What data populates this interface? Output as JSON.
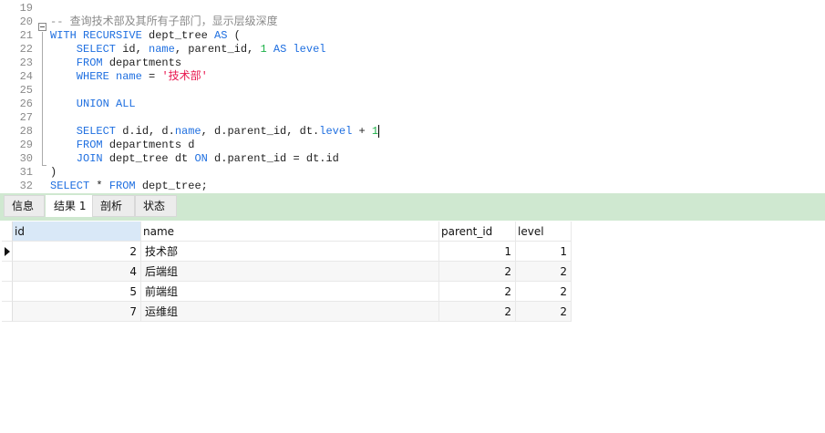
{
  "editor": {
    "lines": [
      {
        "n": "19",
        "tokens": []
      },
      {
        "n": "20",
        "tokens": [
          {
            "t": "-- 查询技术部及其所有子部门，显示层级深度",
            "c": "cm"
          }
        ]
      },
      {
        "n": "21",
        "tokens": [
          {
            "t": "WITH RECURSIVE ",
            "c": "kw"
          },
          {
            "t": "dept_tree ",
            "c": "id"
          },
          {
            "t": "AS",
            "c": "kw"
          },
          {
            "t": " (",
            "c": "id"
          }
        ]
      },
      {
        "n": "22",
        "tokens": [
          {
            "t": "    SELECT ",
            "c": "kw"
          },
          {
            "t": "id, ",
            "c": "id"
          },
          {
            "t": "name",
            "c": "kw"
          },
          {
            "t": ", parent_id, ",
            "c": "id"
          },
          {
            "t": "1 ",
            "c": "num"
          },
          {
            "t": "AS level",
            "c": "kw"
          }
        ]
      },
      {
        "n": "23",
        "tokens": [
          {
            "t": "    FROM ",
            "c": "kw"
          },
          {
            "t": "departments",
            "c": "id"
          }
        ]
      },
      {
        "n": "24",
        "tokens": [
          {
            "t": "    WHERE name ",
            "c": "kw"
          },
          {
            "t": "= ",
            "c": "id"
          },
          {
            "t": "'技术部'",
            "c": "str"
          }
        ]
      },
      {
        "n": "25",
        "tokens": []
      },
      {
        "n": "26",
        "tokens": [
          {
            "t": "    UNION ALL",
            "c": "kw"
          }
        ]
      },
      {
        "n": "27",
        "tokens": []
      },
      {
        "n": "28",
        "tokens": [
          {
            "t": "    SELECT ",
            "c": "kw"
          },
          {
            "t": "d.id, d.",
            "c": "id"
          },
          {
            "t": "name",
            "c": "kw"
          },
          {
            "t": ", d.parent_id, dt.",
            "c": "id"
          },
          {
            "t": "level",
            "c": "kw"
          },
          {
            "t": " + ",
            "c": "id"
          },
          {
            "t": "1",
            "c": "num"
          }
        ]
      },
      {
        "n": "29",
        "tokens": [
          {
            "t": "    FROM ",
            "c": "kw"
          },
          {
            "t": "departments d",
            "c": "id"
          }
        ]
      },
      {
        "n": "30",
        "tokens": [
          {
            "t": "    JOIN ",
            "c": "kw"
          },
          {
            "t": "dept_tree dt ",
            "c": "id"
          },
          {
            "t": "ON ",
            "c": "kw"
          },
          {
            "t": "d.parent_id = dt.id",
            "c": "id"
          }
        ]
      },
      {
        "n": "31",
        "tokens": [
          {
            "t": ")",
            "c": "id"
          }
        ]
      },
      {
        "n": "32",
        "tokens": [
          {
            "t": "SELECT ",
            "c": "kw"
          },
          {
            "t": "* ",
            "c": "id"
          },
          {
            "t": "FROM ",
            "c": "kw"
          },
          {
            "t": "dept_tree;",
            "c": "id"
          }
        ]
      }
    ]
  },
  "tabs": [
    {
      "label": "信息"
    },
    {
      "label": "结果 1"
    },
    {
      "label": "剖析"
    },
    {
      "label": "状态"
    }
  ],
  "result": {
    "columns": [
      "id",
      "name",
      "parent_id",
      "level"
    ],
    "rows": [
      {
        "id": "2",
        "name": "技术部",
        "parent_id": "1",
        "level": "1"
      },
      {
        "id": "4",
        "name": "后端组",
        "parent_id": "2",
        "level": "2"
      },
      {
        "id": "5",
        "name": "前端组",
        "parent_id": "2",
        "level": "2"
      },
      {
        "id": "7",
        "name": "运维组",
        "parent_id": "2",
        "level": "2"
      }
    ]
  }
}
